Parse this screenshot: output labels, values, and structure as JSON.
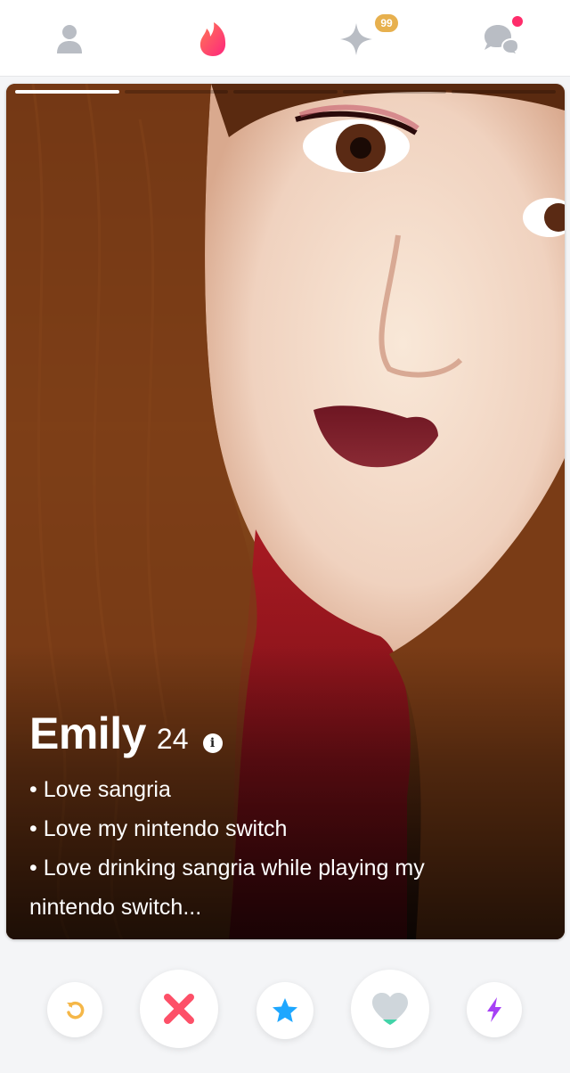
{
  "nav": {
    "items": [
      "profile-icon",
      "flame-icon",
      "gold-sparkle-icon",
      "messages-icon"
    ],
    "gold_badge": "99"
  },
  "card": {
    "photo_count": 5,
    "current_photo": 1,
    "name": "Emily",
    "age": "24",
    "info_icon_glyph": "i",
    "bio": [
      "• Love sangria",
      "• Love my nintendo switch",
      "• Love drinking sangria while playing my",
      "nintendo switch..."
    ]
  },
  "actions": [
    "rewind-icon",
    "nope-icon",
    "super-like-icon",
    "like-icon",
    "boost-icon"
  ],
  "colors": {
    "brand_flame": "#fd5068",
    "nope": "#fd5068",
    "rewind": "#f5b748",
    "super_like": "#1ea7ff",
    "like": "#cfd6db",
    "boost": "#a640f5",
    "gold": "#e7b04e",
    "icon_gray": "#b8bcc3"
  }
}
